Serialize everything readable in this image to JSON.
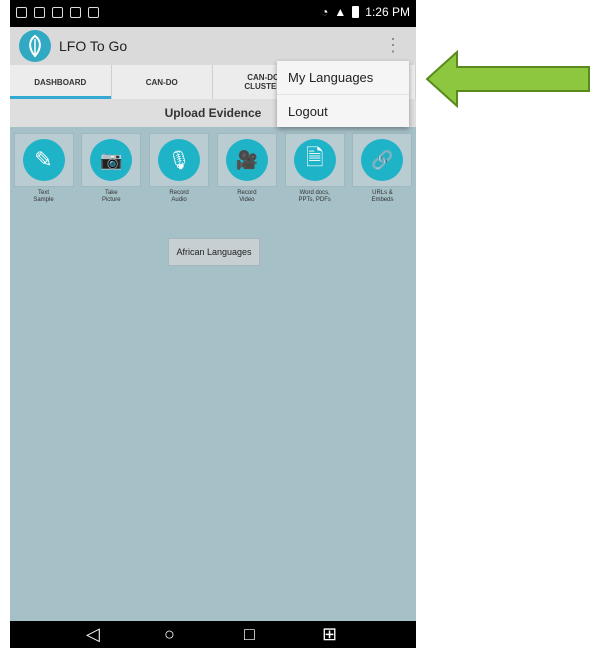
{
  "status_bar": {
    "time": "1:26 PM"
  },
  "app": {
    "title": "LFO To Go",
    "overflow_icon": "⋮"
  },
  "tabs": [
    {
      "label": "DASHBOARD",
      "active": true
    },
    {
      "label": "CAN-DO",
      "active": false
    },
    {
      "label": "CAN-DO\nCLUSTER",
      "active": false
    },
    {
      "label": "",
      "active": false
    }
  ],
  "upload": {
    "title": "Upload Evidence",
    "tiles": [
      {
        "label": "Text\nSample",
        "icon": "edit-document-icon",
        "glyph": "✎"
      },
      {
        "label": "Take\nPicture",
        "icon": "camera-icon",
        "glyph": "📷"
      },
      {
        "label": "Record\nAudio",
        "icon": "microphone-icon",
        "glyph": "🎙"
      },
      {
        "label": "Record\nVideo",
        "icon": "video-camera-icon",
        "glyph": "🎥"
      },
      {
        "label": "Word docs,\nPPTs, PDFs",
        "icon": "documents-audio-icon",
        "glyph": "🗎"
      },
      {
        "label": "URLs &\nEmbeds",
        "icon": "link-icon",
        "glyph": "🔗"
      }
    ]
  },
  "language_button": "African Languages",
  "menu": {
    "items": [
      "My Languages",
      "Logout"
    ]
  },
  "colors": {
    "accent": "#1fb3c8",
    "arrow": "#8dc63f",
    "content_bg": "#a6c0c8"
  }
}
